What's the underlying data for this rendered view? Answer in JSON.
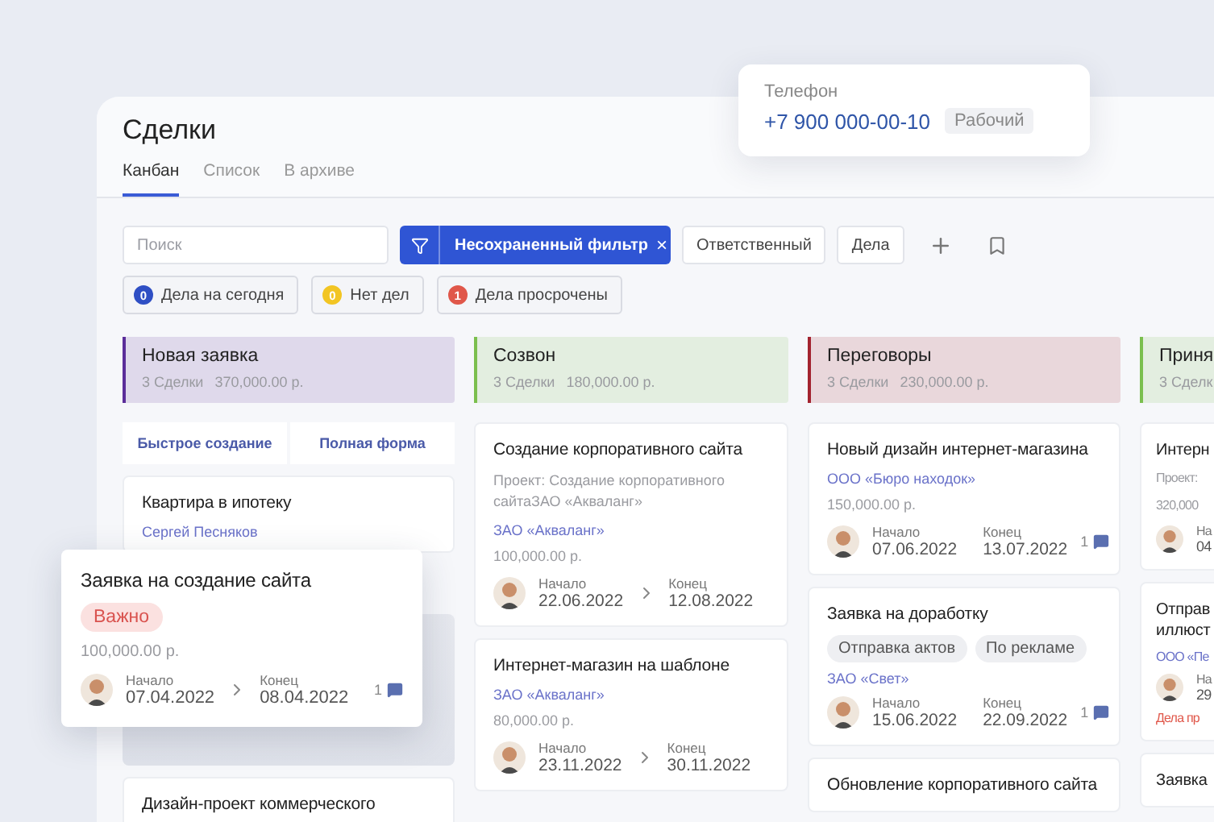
{
  "popup": {
    "label": "Телефон",
    "phone": "+7 900 000-00-10",
    "type": "Рабочий"
  },
  "page": {
    "title": "Сделки"
  },
  "tabs": [
    {
      "label": "Канбан",
      "selected": true
    },
    {
      "label": "Список",
      "selected": false
    },
    {
      "label": "В архиве",
      "selected": false
    }
  ],
  "toolbar": {
    "search_placeholder": "Поиск",
    "filter": {
      "label": "Несохраненный фильтр",
      "close": "×"
    },
    "buttons": [
      "Ответственный",
      "Дела"
    ]
  },
  "quick_filters": [
    {
      "count": "0",
      "label": "Дела на сегодня",
      "color": "#2f4fc4"
    },
    {
      "count": "0",
      "label": "Нет дел",
      "color": "#f2c523"
    },
    {
      "count": "1",
      "label": "Дела просрочены",
      "color": "#e0574a"
    }
  ],
  "columns": [
    {
      "title": "Новая заявка",
      "count": "3 Сделки",
      "total": "370,000.00 р.",
      "color": "#5b2d9a",
      "quick_actions": [
        "Быстрое создание",
        "Полная форма"
      ],
      "cards": [
        {
          "kind": "deal",
          "title": "Квартира в ипотеку",
          "company": "Сергей Песняков"
        },
        {
          "kind": "placeholder"
        },
        {
          "kind": "deal",
          "title": "Дизайн-проект коммерческого"
        }
      ]
    },
    {
      "title": "Созвон",
      "count": "3 Сделки",
      "total": "180,000.00 р.",
      "color": "#7bbf4e",
      "cards": [
        {
          "kind": "deal",
          "title": "Создание корпоративного сайта",
          "project": "Проект: Создание корпоративного сайтаЗАО «Акваланг»",
          "company": "ЗАО «Акваланг»",
          "amount": "100,000.00 р.",
          "start": {
            "label": "Начало",
            "date": "22.06.2022"
          },
          "end": {
            "label": "Конец",
            "date": "12.08.2022"
          }
        },
        {
          "kind": "deal",
          "title": "Интернет-магазин на шаблоне",
          "company": "ЗАО «Акваланг»",
          "amount": "80,000.00 р.",
          "start": {
            "label": "Начало",
            "date": "23.11.2022"
          },
          "end": {
            "label": "Конец",
            "date": "30.11.2022"
          }
        }
      ]
    },
    {
      "title": "Переговоры",
      "count": "3 Сделки",
      "total": "230,000.00 р.",
      "color": "#a3232f",
      "cards": [
        {
          "kind": "deal",
          "title": "Новый дизайн интернет-магазина",
          "company": "ООО «Бюро находок»",
          "amount": "150,000.00 р.",
          "start": {
            "label": "Начало",
            "date": "07.06.2022"
          },
          "end": {
            "label": "Конец",
            "date": "13.07.2022"
          },
          "comments": "1"
        },
        {
          "kind": "deal",
          "title": "Заявка на доработку",
          "tags": [
            "Отправка актов",
            "По рекламе"
          ],
          "company": "ЗАО «Свет»",
          "start": {
            "label": "Начало",
            "date": "15.06.2022"
          },
          "end": {
            "label": "Конец",
            "date": "22.09.2022"
          },
          "comments": "1"
        },
        {
          "kind": "deal",
          "title": "Обновление корпоративного сайта"
        }
      ]
    },
    {
      "title": "Приня",
      "count": "3 Сделк",
      "color": "#7bbf4e",
      "cards": [
        {
          "kind": "deal",
          "title": "Интерн",
          "project": "Проект:",
          "amount": "320,000",
          "start": {
            "label": "На",
            "date": "04"
          }
        },
        {
          "kind": "deal",
          "title": "Отправ иллюст",
          "company": "ООО «Пе",
          "start": {
            "label": "На",
            "date": "29"
          },
          "overdue": "Дела пр"
        },
        {
          "kind": "deal",
          "title": "Заявка"
        }
      ]
    }
  ],
  "dragged_card": {
    "title": "Заявка на создание сайта",
    "badge": "Важно",
    "amount": "100,000.00 р.",
    "start": {
      "label": "Начало",
      "date": "07.04.2022"
    },
    "end": {
      "label": "Конец",
      "date": "08.04.2022"
    },
    "comments": "1"
  }
}
